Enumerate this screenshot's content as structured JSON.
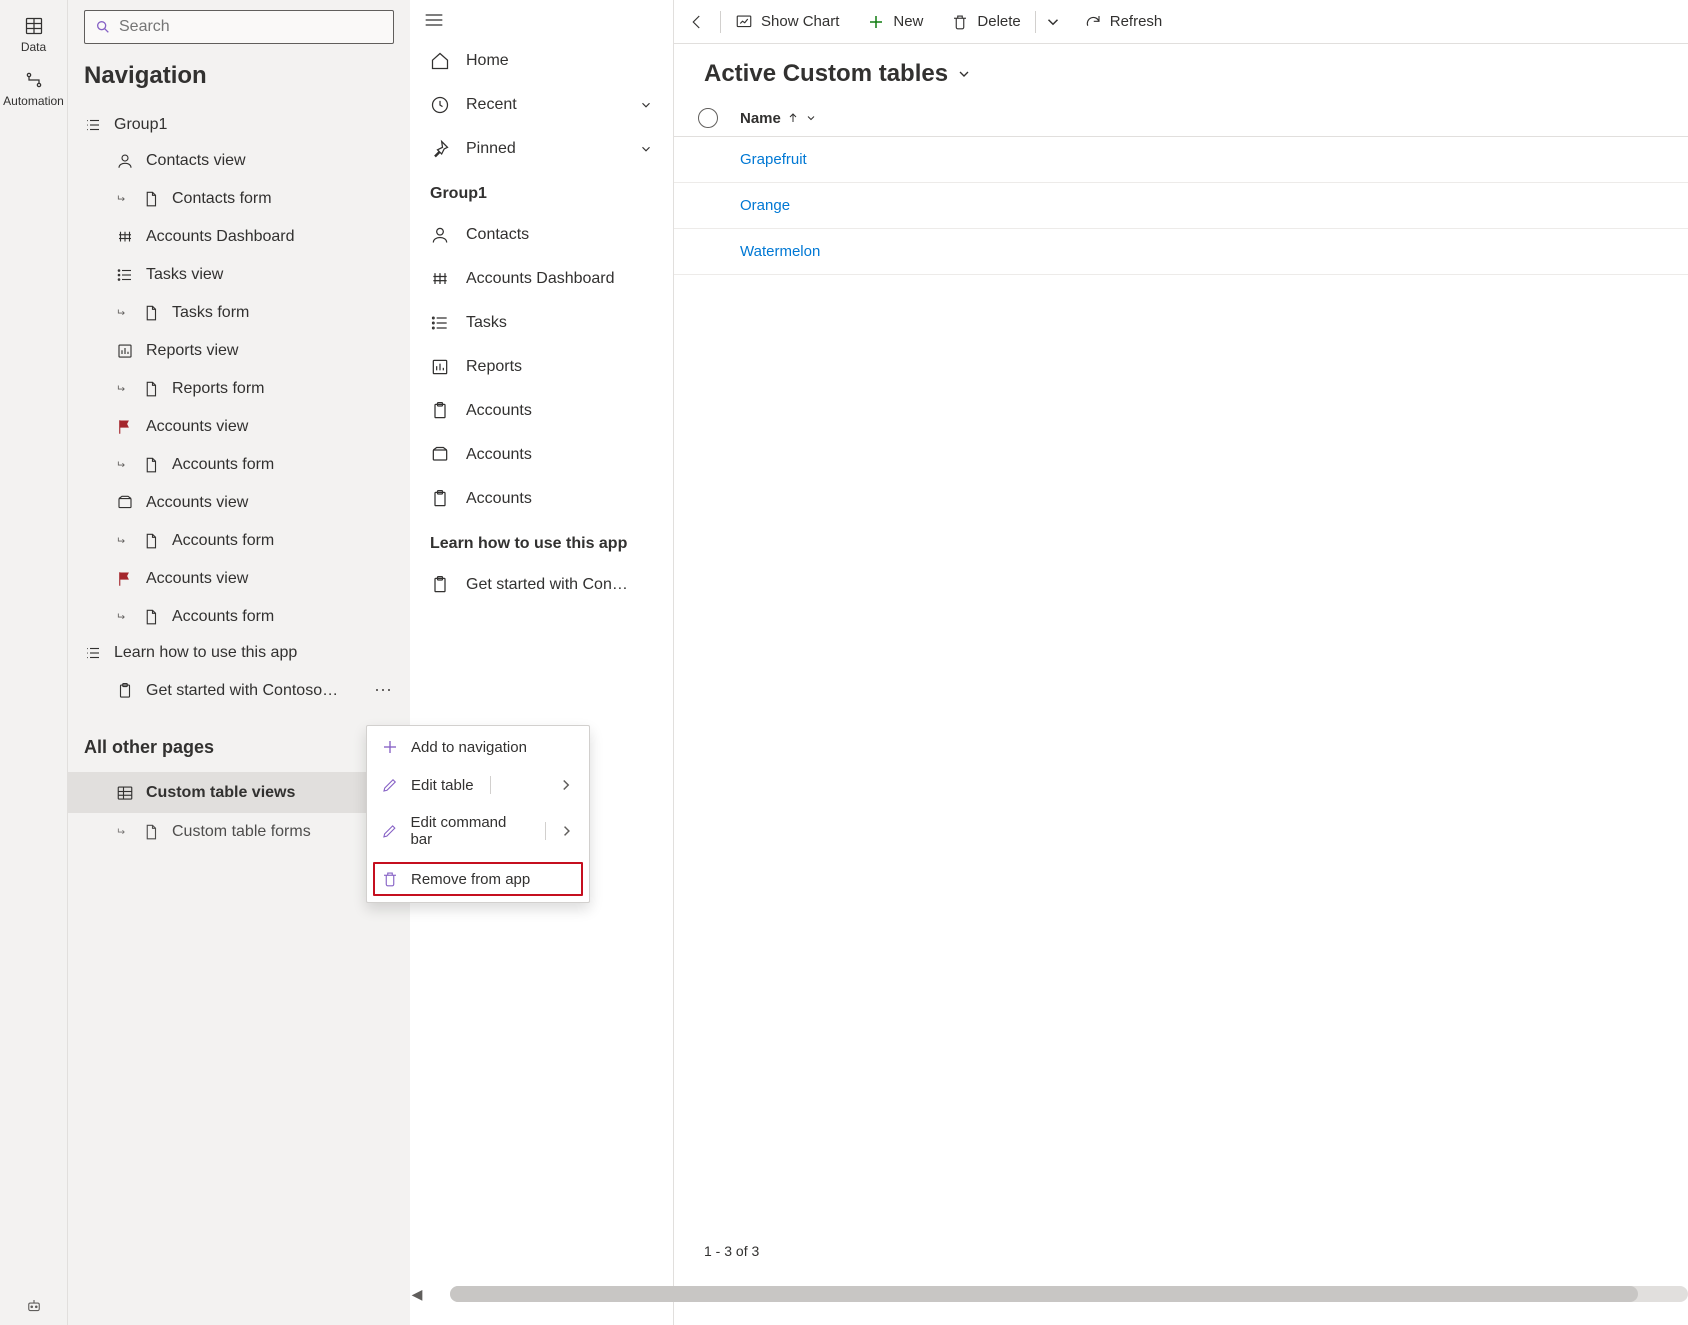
{
  "left_rail": {
    "data_label": "Data",
    "automation_label": "Automation"
  },
  "nav_panel": {
    "search_placeholder": "Search",
    "title": "Navigation",
    "group1_label": "Group1",
    "items": [
      {
        "label": "Contacts view",
        "icon": "person"
      },
      {
        "label": "Contacts form",
        "icon": "form",
        "indent": true
      },
      {
        "label": "Accounts Dashboard",
        "icon": "dashboard"
      },
      {
        "label": "Tasks view",
        "icon": "list"
      },
      {
        "label": "Tasks form",
        "icon": "form",
        "indent": true
      },
      {
        "label": "Reports view",
        "icon": "reports"
      },
      {
        "label": "Reports form",
        "icon": "form",
        "indent": true
      },
      {
        "label": "Accounts view",
        "icon": "flag"
      },
      {
        "label": "Accounts form",
        "icon": "form",
        "indent": true
      },
      {
        "label": "Accounts view",
        "icon": "accview"
      },
      {
        "label": "Accounts form",
        "icon": "form",
        "indent": true
      },
      {
        "label": "Accounts view",
        "icon": "flag"
      },
      {
        "label": "Accounts form",
        "icon": "form",
        "indent": true
      }
    ],
    "learn_label": "Learn how to use this app",
    "learn_item": "Get started with Contoso…",
    "other_pages_title": "All other pages",
    "selected_item": "Custom table views",
    "last_item": "Custom table forms"
  },
  "appnav": {
    "home": "Home",
    "recent": "Recent",
    "pinned": "Pinned",
    "group1": "Group1",
    "items": [
      {
        "label": "Contacts",
        "icon": "person"
      },
      {
        "label": "Accounts Dashboard",
        "icon": "dashboard"
      },
      {
        "label": "Tasks",
        "icon": "list"
      },
      {
        "label": "Reports",
        "icon": "reports"
      },
      {
        "label": "Accounts",
        "icon": "clipboard"
      },
      {
        "label": "Accounts",
        "icon": "accview"
      },
      {
        "label": "Accounts",
        "icon": "clipboard"
      }
    ],
    "learn_header": "Learn how to use this app",
    "learn_item": "Get started with Con…"
  },
  "cmdbar": {
    "show_chart": "Show Chart",
    "new": "New",
    "delete": "Delete",
    "refresh": "Refresh"
  },
  "main": {
    "view_title": "Active Custom tables",
    "name_col": "Name",
    "rows": [
      "Grapefruit",
      "Orange",
      "Watermelon"
    ],
    "row_count": "1 - 3 of 3"
  },
  "context_menu": {
    "add_nav": "Add to navigation",
    "edit_table": "Edit table",
    "edit_cmd": "Edit command bar",
    "remove": "Remove from app"
  }
}
